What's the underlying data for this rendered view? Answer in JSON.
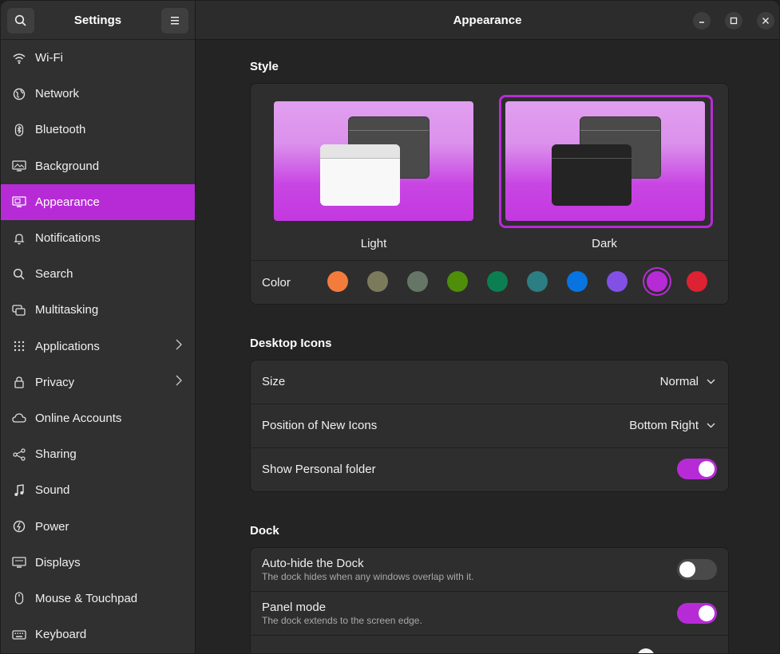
{
  "sidebar": {
    "title": "Settings",
    "items": [
      {
        "label": "Wi-Fi",
        "icon": "wifi-icon"
      },
      {
        "label": "Network",
        "icon": "network-icon"
      },
      {
        "label": "Bluetooth",
        "icon": "bluetooth-icon"
      },
      {
        "label": "Background",
        "icon": "background-icon"
      },
      {
        "label": "Appearance",
        "icon": "appearance-icon",
        "active": true
      },
      {
        "label": "Notifications",
        "icon": "bell-icon"
      },
      {
        "label": "Search",
        "icon": "search-icon"
      },
      {
        "label": "Multitasking",
        "icon": "multitasking-icon"
      },
      {
        "label": "Applications",
        "icon": "grid-icon",
        "chevron": true
      },
      {
        "label": "Privacy",
        "icon": "lock-icon",
        "chevron": true
      },
      {
        "label": "Online Accounts",
        "icon": "cloud-icon"
      },
      {
        "label": "Sharing",
        "icon": "share-icon"
      },
      {
        "label": "Sound",
        "icon": "music-note-icon"
      },
      {
        "label": "Power",
        "icon": "power-icon"
      },
      {
        "label": "Displays",
        "icon": "display-icon"
      },
      {
        "label": "Mouse & Touchpad",
        "icon": "mouse-icon"
      },
      {
        "label": "Keyboard",
        "icon": "keyboard-icon"
      }
    ]
  },
  "main": {
    "title": "Appearance",
    "style": {
      "heading": "Style",
      "light_label": "Light",
      "dark_label": "Dark",
      "selected": "Dark",
      "color_label": "Color",
      "colors": [
        "#f37c3d",
        "#7b7b5c",
        "#657667",
        "#4e8e0a",
        "#0b7f52",
        "#2c7e82",
        "#0874e1",
        "#8350e6",
        "#b72bd7",
        "#dc2233"
      ],
      "selected_color": "#b72bd7"
    },
    "desktop_icons": {
      "heading": "Desktop Icons",
      "size_label": "Size",
      "size_value": "Normal",
      "position_label": "Position of New Icons",
      "position_value": "Bottom Right",
      "personal_label": "Show Personal folder",
      "personal_on": true
    },
    "dock": {
      "heading": "Dock",
      "autohide_label": "Auto-hide the Dock",
      "autohide_sub": "The dock hides when any windows overlap with it.",
      "autohide_on": false,
      "panel_label": "Panel mode",
      "panel_sub": "The dock extends to the screen edge.",
      "panel_on": true
    }
  },
  "colors": {
    "accent": "#b72bd7"
  }
}
